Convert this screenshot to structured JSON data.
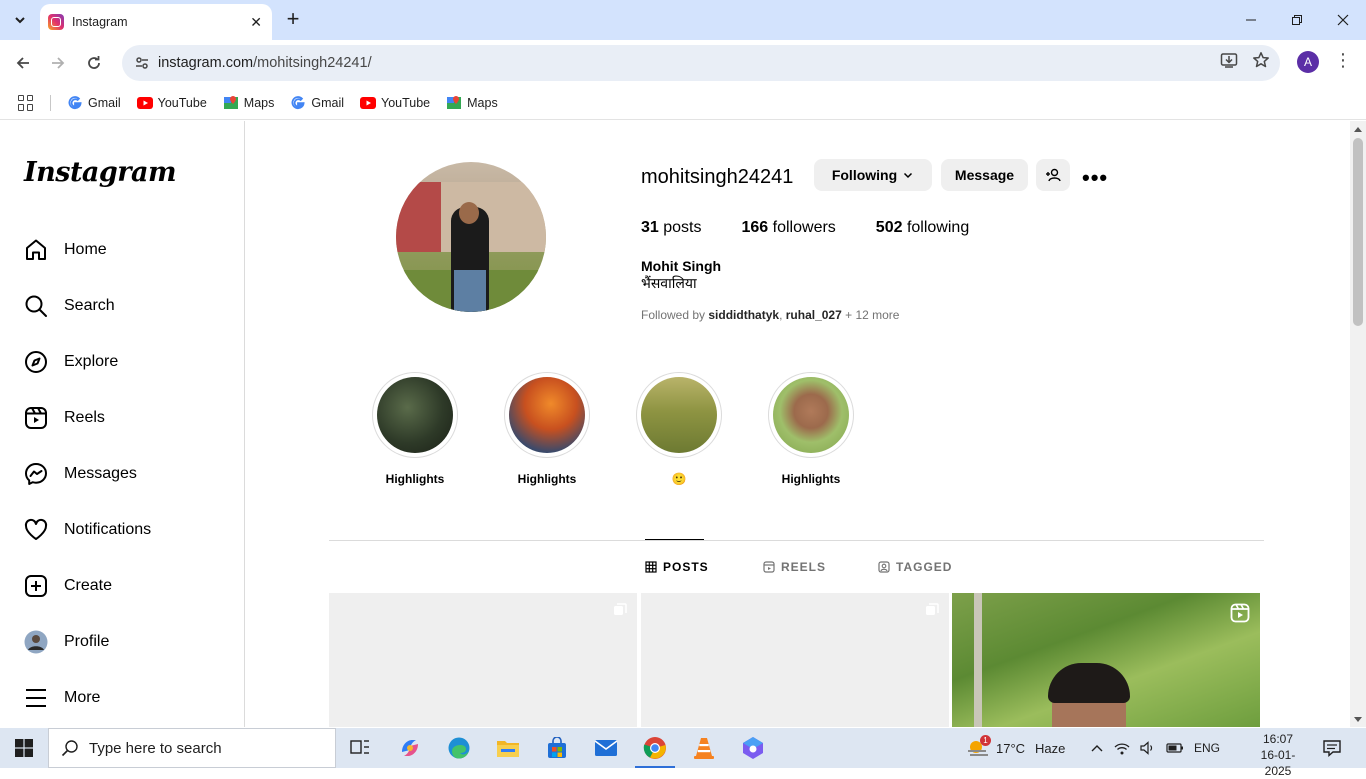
{
  "browser": {
    "tab_title": "Instagram",
    "url_host": "instagram.com",
    "url_path": "/mohitsingh24241/",
    "profile_initial": "A",
    "bookmarks": [
      {
        "label": "Gmail",
        "icon": "google-icon"
      },
      {
        "label": "YouTube",
        "icon": "youtube-icon"
      },
      {
        "label": "Maps",
        "icon": "maps-icon"
      },
      {
        "label": "Gmail",
        "icon": "google-icon"
      },
      {
        "label": "YouTube",
        "icon": "youtube-icon"
      },
      {
        "label": "Maps",
        "icon": "maps-icon"
      }
    ]
  },
  "sidebar": {
    "logo": "Instagram",
    "items": [
      {
        "label": "Home",
        "icon": "home-icon"
      },
      {
        "label": "Search",
        "icon": "search-icon"
      },
      {
        "label": "Explore",
        "icon": "compass-icon"
      },
      {
        "label": "Reels",
        "icon": "reels-icon"
      },
      {
        "label": "Messages",
        "icon": "messenger-icon"
      },
      {
        "label": "Notifications",
        "icon": "heart-icon"
      },
      {
        "label": "Create",
        "icon": "plus-square-icon"
      },
      {
        "label": "Profile",
        "icon": "avatar-icon"
      },
      {
        "label": "More",
        "icon": "menu-icon"
      }
    ]
  },
  "profile": {
    "username": "mohitsingh24241",
    "following_label": "Following",
    "message_label": "Message",
    "posts_count": "31",
    "posts_label": "posts",
    "followers_count": "166",
    "followers_label": "followers",
    "following_count": "502",
    "following_count_label": "following",
    "full_name": "Mohit Singh",
    "bio": "भैंसवालिया",
    "followed_by_prefix": "Followed by ",
    "followed_by_user1": "siddidthatyk",
    "followed_by_sep": ", ",
    "followed_by_user2": "ruhal_027",
    "followed_by_more": " + 12 more"
  },
  "highlights": [
    {
      "label": "Highlights"
    },
    {
      "label": "Highlights"
    },
    {
      "label": "🙂"
    },
    {
      "label": "Highlights"
    }
  ],
  "tabs": [
    {
      "label": "POSTS",
      "active": true
    },
    {
      "label": "REELS",
      "active": false
    },
    {
      "label": "TAGGED",
      "active": false
    }
  ],
  "taskbar": {
    "search_placeholder": "Type here to search",
    "weather_temp": "17°C",
    "weather_desc": "Haze",
    "weather_badge": "1",
    "language": "ENG",
    "time": "16:07",
    "date": "16-01-2025"
  }
}
